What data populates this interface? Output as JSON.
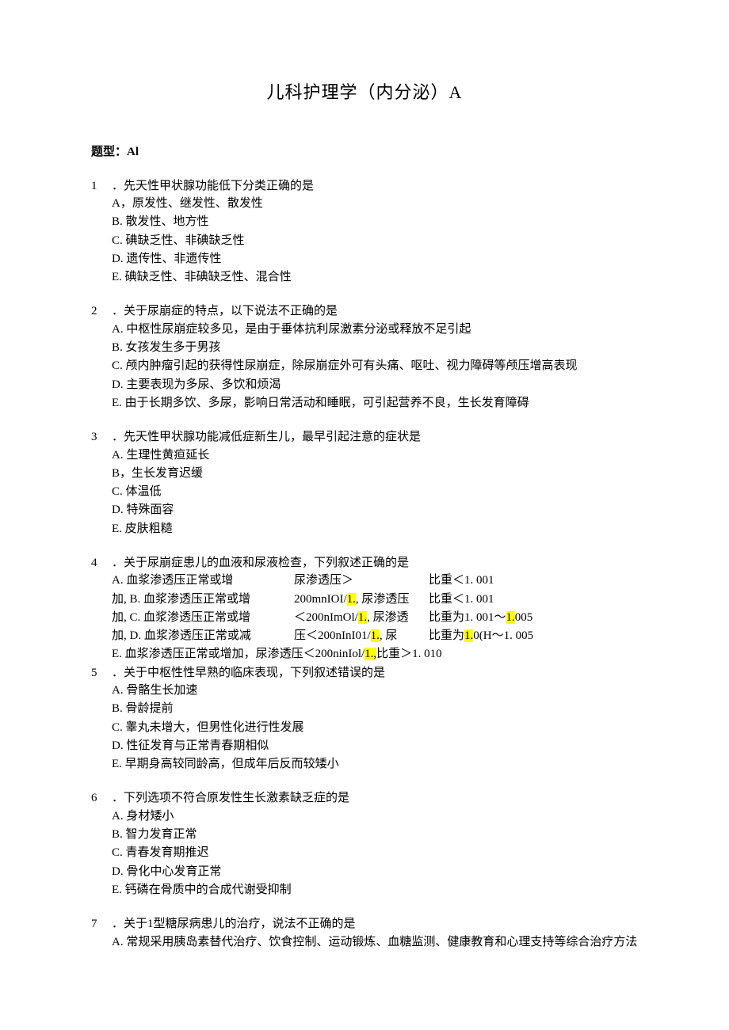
{
  "title": "儿科护理学（内分泌）A",
  "sectionLabel": "题型：Al",
  "q1": {
    "num": "1",
    "stem": "．先天性甲状腺功能低下分类正确的是",
    "A": "A，原发性、继发性、散发性",
    "B": "B. 散发性、地方性",
    "C": "C. 碘缺乏性、非碘缺乏性",
    "D": "D. 遗传性、非遗传性",
    "E": "E. 碘缺乏性、非碘缺乏性、混合性"
  },
  "q2": {
    "num": "2",
    "stem": "．关于尿崩症的特点，以下说法不正确的是",
    "A": "A. 中枢性尿崩症较多见，是由于垂体抗利尿激素分泌或释放不足引起",
    "B": "B. 女孩发生多于男孩",
    "C": "C. 颅内肿瘤引起的获得性尿崩症，除尿崩症外可有头痛、呕吐、视力障碍等颅压增高表现",
    "D": "D. 主要表现为多尿、多饮和烦渴",
    "E": "E. 由于长期多饮、多尿，影响日常活动和睡眠，可引起营养不良，生长发育障碍"
  },
  "q3": {
    "num": "3",
    "stem": "．先天性甲状腺功能减低症新生儿，最早引起注意的症状是",
    "A": "A. 生理性黄疸延长",
    "B": "B，生长发育迟缓",
    "C": "C. 体温低",
    "D": "D. 特殊面容",
    "E": "E. 皮肤粗糙"
  },
  "q4": {
    "num": "4",
    "stem": "．关于尿崩症患儿的血液和尿液检查，下列叙述正确的是",
    "r1c1": "A. 血浆渗透压正常或增",
    "r1c2": "尿渗透压＞",
    "r1c3": "比重＜1. 001",
    "r2c1": "加, B. 血浆渗透压正常或增",
    "r2c2a": "200mnIOI/",
    "r2c2b": "1.",
    "r2c2c": ", 尿渗透压",
    "r2c3": "比重＜1. 001",
    "r3c1": "加, C. 血浆渗透压正常或增",
    "r3c2a": "＜200nImOl/",
    "r3c2b": "1.",
    "r3c2c": ", 尿渗透",
    "r3c3a": "比重为1. 001～",
    "r3c3b": "1.",
    "r3c3c": "005",
    "r4c1": "加, D. 血浆渗透压正常或减",
    "r4c2a": "压＜200nInI01/",
    "r4c2b": "1.",
    "r4c2c": ", 尿",
    "r4c3a": "比重为",
    "r4c3b": "1.",
    "r4c3c": "0(H～1. 005",
    "r5a": "E. 血浆渗透压正常或增加，尿渗透压＜200ninIol/",
    "r5b": "1.,",
    "r5c": "比重＞1. 010"
  },
  "q5": {
    "num": "5",
    "stem": "．关于中枢性性早熟的临床表现，下列叙述错误的是",
    "A": "A. 骨骼生长加速",
    "B": "B. 骨龄提前",
    "C": "C. 睾丸未增大，但男性化进行性发展",
    "D": "D. 性征发育与正常青春期相似",
    "E": "E. 早期身高较同龄高，但成年后反而较矮小"
  },
  "q6": {
    "num": "6",
    "stem": "．下列选项不符合原发性生长激素缺乏症的是",
    "A": "A. 身材矮小",
    "B": "B. 智力发育正常",
    "C": "C. 青春发育期推迟",
    "D": "D. 骨化中心发育正常",
    "E": "E. 钙磷在骨质中的合成代谢受抑制"
  },
  "q7": {
    "num": "7",
    "stem": "．关于1型糖尿病患儿的治疗，说法不正确的是",
    "A": "A. 常规采用胰岛素替代治疗、饮食控制、运动锻炼、血糖监测、健康教育和心理支持等综合治疗方法"
  }
}
